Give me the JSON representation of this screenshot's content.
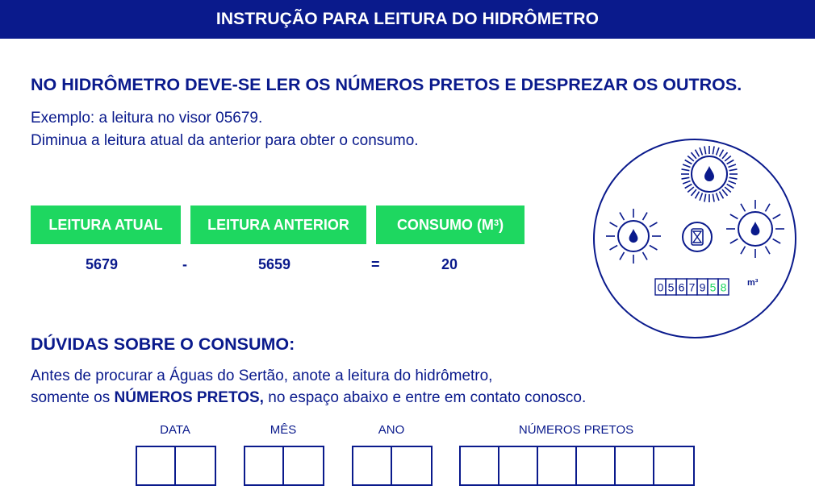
{
  "header": {
    "title": "INSTRUÇÃO PARA LEITURA DO HIDRÔMETRO"
  },
  "instructions": {
    "heading": "NO HIDRÔMETRO DEVE-SE LER OS NÚMEROS PRETOS E DESPREZAR OS OUTROS.",
    "example_line1": "Exemplo: a leitura no visor 05679.",
    "example_line2": "Diminua a leitura atual da anterior para obter o consumo."
  },
  "calculation": {
    "current_label": "LEITURA ATUAL",
    "previous_label": "LEITURA ANTERIOR",
    "consumption_label": "CONSUMO (M",
    "consumption_sup": "3",
    "consumption_close": ")",
    "current_value": "5679",
    "minus": "-",
    "previous_value": "5659",
    "equals": "=",
    "consumption_value": "20"
  },
  "meter": {
    "digits_black": [
      "0",
      "5",
      "6",
      "7",
      "9"
    ],
    "digits_green": [
      "5",
      "8"
    ],
    "unit": "m³",
    "colors": {
      "dark": "#0a1a8c",
      "green": "#1ed760"
    }
  },
  "doubts": {
    "heading": "DÚVIDAS SOBRE O CONSUMO:",
    "line1": "Antes de procurar a Águas do Sertão, anote a leitura do hidrômetro,",
    "line2_before": "somente os ",
    "line2_bold": "NÚMEROS PRETOS,",
    "line2_after": " no espaço abaixo e entre em contato conosco."
  },
  "form": {
    "day_label": "DATA",
    "month_label": "MÊS",
    "year_label": "ANO",
    "numbers_label": "NÚMEROS PRETOS"
  }
}
